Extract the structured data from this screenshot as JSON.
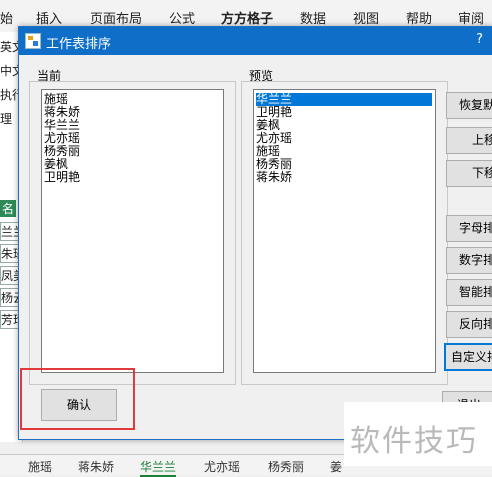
{
  "ribbon": {
    "tabs": [
      "始",
      "插入",
      "页面布局",
      "公式",
      "方方格子",
      "数据",
      "视图",
      "帮助",
      "审阅"
    ]
  },
  "left_strip": {
    "items": [
      "英文",
      "中文",
      "执行",
      "理",
      "名",
      "兰兰",
      "朱瑶",
      "凤美",
      "杨云",
      "芳珍"
    ]
  },
  "dialog": {
    "title": "工作表排序",
    "help": "?",
    "current_label": "当前",
    "preview_label": "预览",
    "current_items": [
      "施瑶",
      "蒋朱娇",
      "华兰兰",
      "尤亦瑶",
      "杨秀丽",
      "姜枫",
      "卫明艳"
    ],
    "preview_items": [
      "华兰兰",
      "卫明艳",
      "姜枫",
      "尤亦瑶",
      "施瑶",
      "杨秀丽",
      "蒋朱娇"
    ],
    "preview_selected": "华兰兰",
    "buttons": {
      "restore": "恢复默认",
      "move_up": "上移",
      "move_down": "下移",
      "alpha_sort": "字母排序",
      "numeric_sort": "数字排序",
      "smart_sort": "智能排序",
      "reverse_sort": "反向排序",
      "custom_sort": "自定义排序",
      "confirm": "确认",
      "exit": "退出"
    }
  },
  "sheet_tabs": [
    "施瑶",
    "蒋朱娇",
    "华兰兰",
    "尤亦瑶",
    "杨秀丽",
    "姜"
  ],
  "active_sheet": "华兰兰",
  "watermark": "软件技巧"
}
